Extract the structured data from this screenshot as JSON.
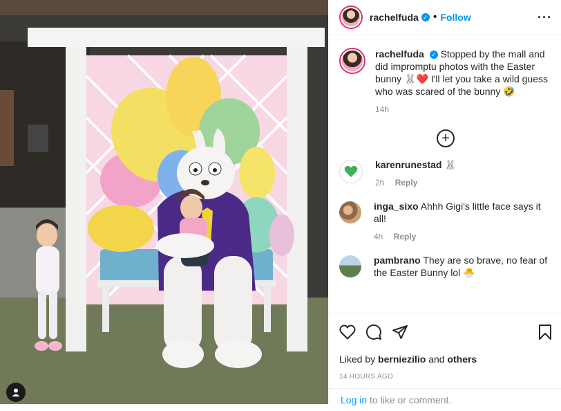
{
  "post": {
    "username": "rachelfuda",
    "follow_label": "Follow",
    "more_icon": "more-horizontal-icon",
    "caption_text": "Stopped by the mall and did impromptu photos with the Easter bunny 🐰❤️ I'll let you take a wild guess who was scared of the bunny 🤣",
    "caption_time": "14h",
    "load_more_icon": "plus-circle-icon"
  },
  "comments": [
    {
      "username": "karenrunestad",
      "text": "🐰",
      "time": "2h",
      "reply_label": "Reply"
    },
    {
      "username": "inga_sixo",
      "text": "Ahhh Gigi's little face says it all!",
      "time": "4h",
      "reply_label": "Reply"
    },
    {
      "username": "pambrano",
      "text": "They are so brave, no fear of the Easter Bunny lol 🐣",
      "time": "",
      "reply_label": ""
    }
  ],
  "footer": {
    "liked_prefix": "Liked by",
    "liked_user": "berniezilio",
    "liked_and": "and",
    "liked_others": "others",
    "timestamp": "14 HOURS AGO",
    "login_link": "Log in",
    "login_rest": "to like or comment."
  },
  "colors": {
    "link": "#0095f6",
    "muted": "#8e8e8e",
    "text": "#262626",
    "ring": "#e1306c"
  }
}
